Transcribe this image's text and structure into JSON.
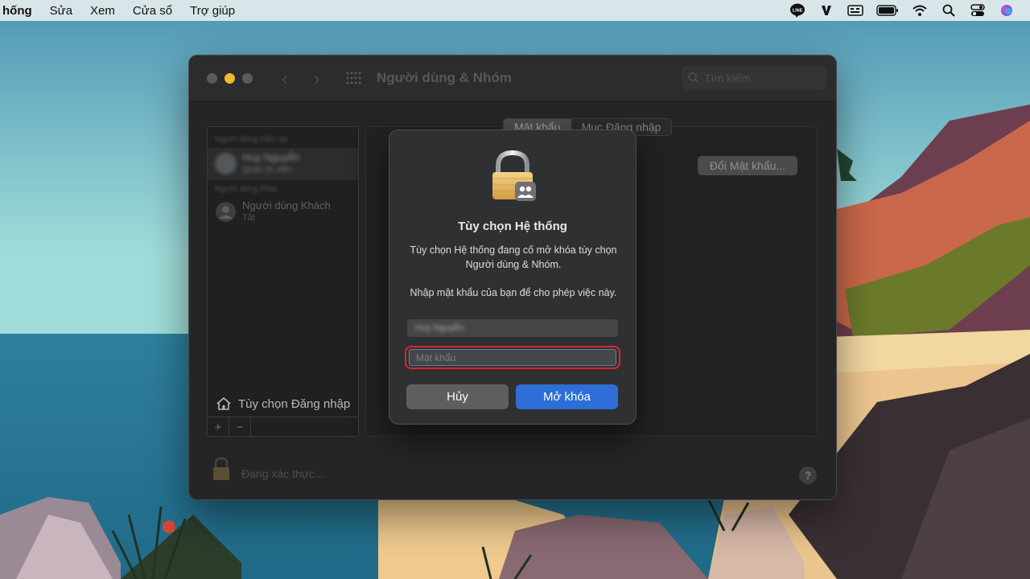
{
  "menubar": {
    "items": [
      "hống",
      "Sửa",
      "Xem",
      "Cửa sổ",
      "Trợ giúp"
    ],
    "tray_icons": [
      "line-icon",
      "v-icon",
      "keyboard-input-icon",
      "battery-icon",
      "wifi-icon",
      "search-icon",
      "control-center-icon",
      "siri-icon"
    ]
  },
  "window": {
    "title": "Người dùng & Nhóm",
    "search_placeholder": "Tìm kiếm",
    "tabs": [
      "Mật khẩu",
      "Mục Đăng nhập"
    ],
    "change_password_label": "Đổi Mật khẩu...",
    "sidebar": {
      "current_users_header": "Người dùng Hiện tại",
      "current_user_name": "Huy Nguyễn",
      "current_user_role": "Quản trị viên",
      "other_users_header": "Người dùng Khác",
      "guest_name": "Người dùng Khách",
      "guest_status": "Tắt",
      "login_options_label": "Tùy chọn Đăng nhập",
      "add_label": "+",
      "remove_label": "−"
    },
    "auth_status": "Đang xác thực...",
    "help_label": "?"
  },
  "dialog": {
    "title": "Tùy chọn Hệ thống",
    "message_line1": "Tùy chọn Hệ thống đang cố mở khóa tùy chọn Người dùng & Nhóm.",
    "message_line2": "Nhập mật khẩu của bạn để cho phép việc này.",
    "username_value": "Huy Nguyễn",
    "password_placeholder": "Mật khẩu",
    "cancel_label": "Hủy",
    "unlock_label": "Mở khóa"
  },
  "colors": {
    "accent_blue": "#2d6fd6",
    "highlight_red": "#e3262a",
    "traffic_light_yellow": "#f5b82e"
  }
}
